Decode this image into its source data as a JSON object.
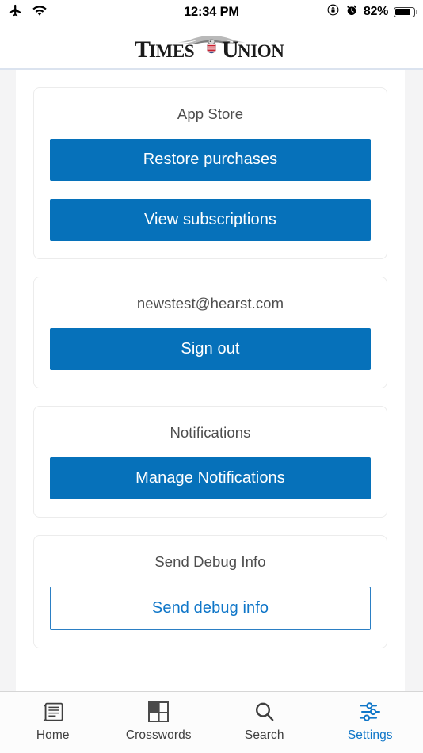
{
  "status_bar": {
    "airplane_icon": "airplane-mode-icon",
    "wifi_icon": "wifi-icon",
    "time": "12:34 PM",
    "rotation_lock_icon": "rotation-lock-icon",
    "alarm_icon": "alarm-clock-icon",
    "battery_percent": "82%",
    "battery_icon": "battery-icon"
  },
  "header": {
    "logo_text_left": "TIMES",
    "logo_text_right": "UNION",
    "logo_emblem": "eagle-emblem-icon"
  },
  "cards": [
    {
      "title": "App Store",
      "buttons": [
        {
          "label": "Restore purchases",
          "style": "filled"
        },
        {
          "label": "View subscriptions",
          "style": "filled"
        }
      ]
    },
    {
      "title": "newstest@hearst.com",
      "buttons": [
        {
          "label": "Sign out",
          "style": "filled"
        }
      ]
    },
    {
      "title": "Notifications",
      "buttons": [
        {
          "label": "Manage Notifications",
          "style": "filled"
        }
      ]
    },
    {
      "title": "Send Debug Info",
      "buttons": [
        {
          "label": "Send debug info",
          "style": "outline"
        }
      ]
    }
  ],
  "tabs": [
    {
      "label": "Home",
      "icon": "newspaper-icon",
      "active": false
    },
    {
      "label": "Crosswords",
      "icon": "crossword-grid-icon",
      "active": false
    },
    {
      "label": "Search",
      "icon": "search-icon",
      "active": false
    },
    {
      "label": "Settings",
      "icon": "sliders-icon",
      "active": true
    }
  ],
  "colors": {
    "accent_blue": "#0671ba",
    "tab_active_blue": "#0f76c8",
    "page_background": "#f4f4f5",
    "card_border": "#ececec",
    "header_rule": "#dbe3ef"
  }
}
